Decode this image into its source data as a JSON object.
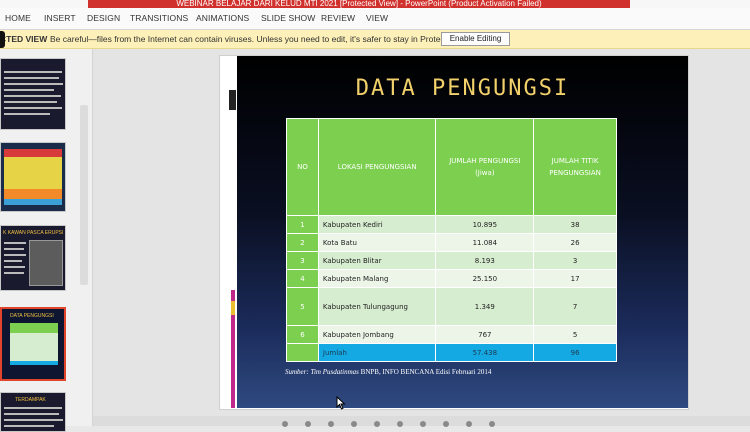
{
  "window": {
    "title": "WEBINAR BELAJAR DARI KELUD MTI 2021 [Protected View] - PowerPoint (Product Activation Failed)"
  },
  "ribbon": {
    "tabs": [
      "HOME",
      "INSERT",
      "DESIGN",
      "TRANSITIONS",
      "ANIMATIONS",
      "SLIDE SHOW",
      "REVIEW",
      "VIEW"
    ]
  },
  "protected_view": {
    "title": "CTED VIEW",
    "message": "Be careful—files from the Internet can contain viruses. Unless you need to edit, it's safer to stay in Protected View.",
    "button": "Enable Editing"
  },
  "thumbnails": [
    {
      "title": ""
    },
    {
      "title": ""
    },
    {
      "title": "K KAWAN PASCA ERUPSI"
    },
    {
      "title": "DATA PENGUNGSI"
    },
    {
      "title": "TERDAMPAK"
    }
  ],
  "slide": {
    "title": "DATA PENGUNGSI",
    "table": {
      "headers": [
        "NO",
        "LOKASI PENGUNGSIAN",
        "JUMLAH PENGUNGSI (Jiwa)",
        "JUMLAH TITIK PENGUNGSIAN"
      ],
      "rows": [
        [
          "1",
          "Kabupaten Kediri",
          "10.895",
          "38"
        ],
        [
          "2",
          "Kota Batu",
          "11.084",
          "26"
        ],
        [
          "3",
          "Kabupaten Blitar",
          "8.193",
          "3"
        ],
        [
          "4",
          "Kabupaten Malang",
          "25.150",
          "17"
        ],
        [
          "5",
          "Kabupaten Tulungagung",
          "1.349",
          "7"
        ],
        [
          "6",
          "Kabupaten Jombang",
          "767",
          "5"
        ]
      ],
      "total": [
        "",
        "Jumlah",
        "57.438",
        "96"
      ]
    },
    "source_label": "Sumber: Tim Pusdatinmas",
    "source_rest": "BNPB, INFO BENCANA Edisi Februari 2014"
  },
  "colors": {
    "title_red": "#d0312d",
    "table_green": "#7ccf4f",
    "total_blue": "#14a9e3",
    "slide_title": "#f2d16b"
  }
}
